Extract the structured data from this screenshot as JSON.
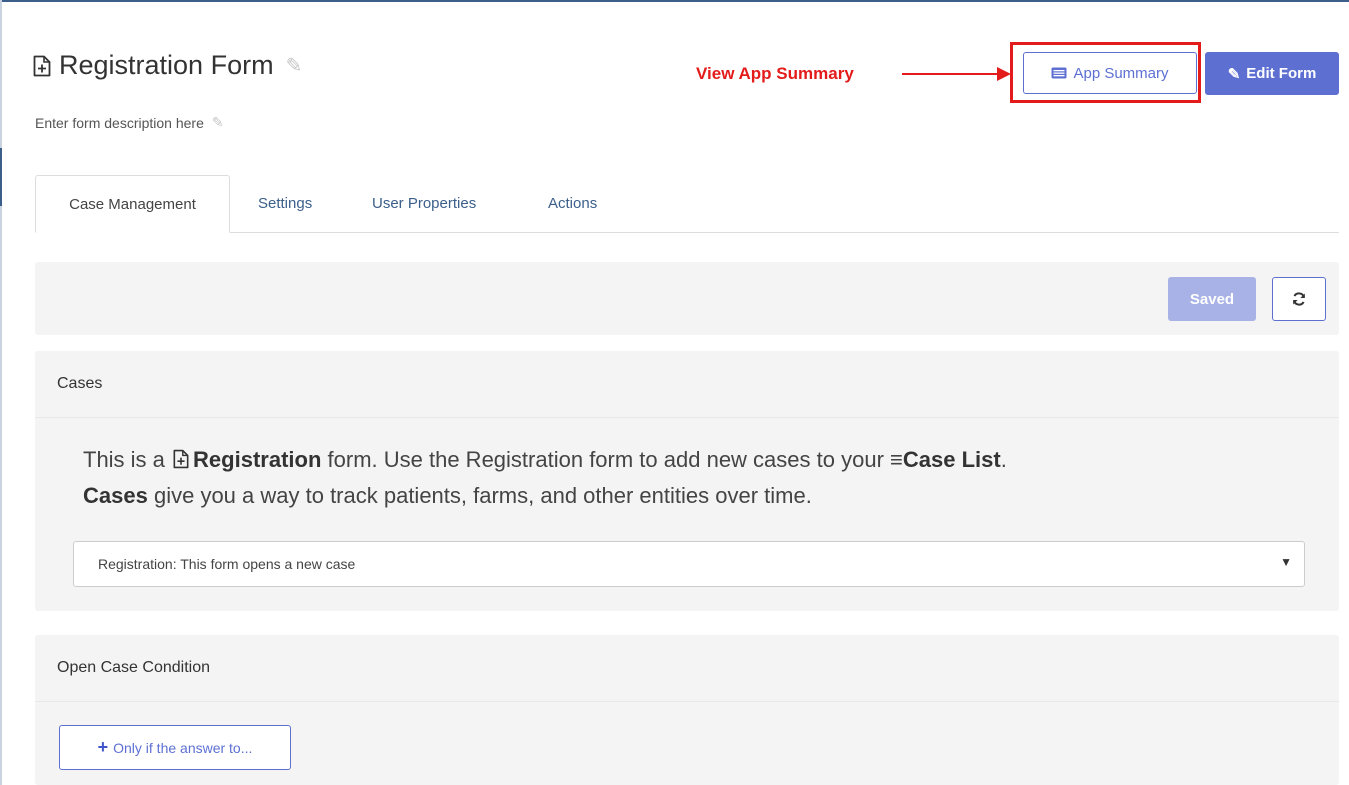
{
  "header": {
    "title": "Registration Form",
    "description": "Enter form description here",
    "app_summary_label": "App Summary",
    "edit_form_label": "Edit Form"
  },
  "annotation": {
    "text": "View App Summary",
    "color": "#e31b1b"
  },
  "tabs": [
    {
      "label": "Case Management",
      "active": true
    },
    {
      "label": "Settings",
      "active": false
    },
    {
      "label": "User Properties",
      "active": false
    },
    {
      "label": "Actions",
      "active": false
    }
  ],
  "toolbar": {
    "saved_label": "Saved",
    "refresh_icon": "refresh-icon"
  },
  "cases_panel": {
    "heading": "Cases",
    "lead": {
      "part1": "This is a",
      "registration": "Registration",
      "part2": "form. Use the Registration form to add new cases to your",
      "case_list": "Case List",
      "part3": ".",
      "cases": "Cases",
      "part4": "give you a way to track patients, farms, and other entities over time."
    },
    "select_value": "Registration: This form opens a new case"
  },
  "condition_panel": {
    "heading": "Open Case Condition",
    "button_label": "Only if the answer to..."
  },
  "colors": {
    "accent": "#5d70d2",
    "accent_disabled": "#a8b2e6",
    "panel_bg": "#f4f4f4",
    "link": "#3b5f8a"
  }
}
